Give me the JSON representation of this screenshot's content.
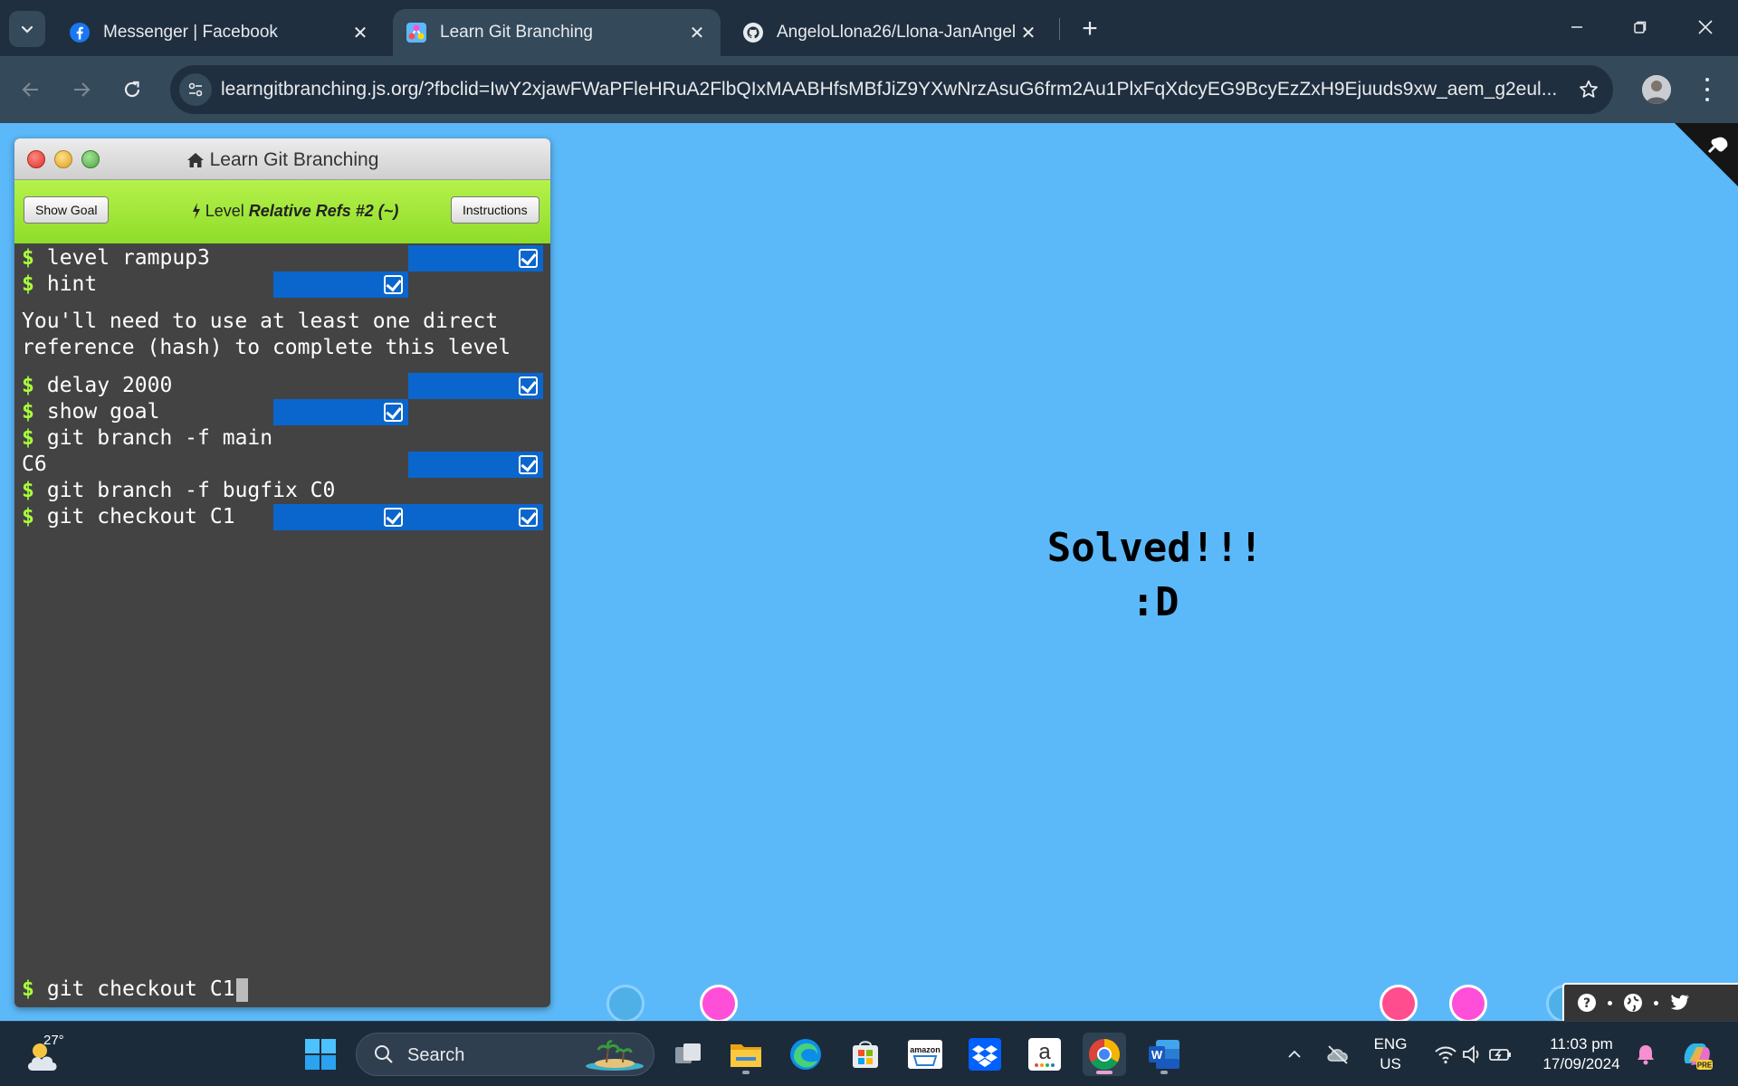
{
  "browser": {
    "tabs": [
      {
        "title": "Messenger | Facebook",
        "icon": "facebook-icon",
        "active": false
      },
      {
        "title": "Learn Git Branching",
        "icon": "git-branching-icon",
        "active": true
      },
      {
        "title": "AngeloLlona26/Llona-JanAngel",
        "icon": "github-icon",
        "active": false
      }
    ],
    "new_tab_label": "+",
    "url": "learngitbranching.js.org/?fbclid=IwY2xjawFWaPFleHRuA2FlbQIxMAABHfsMBfJiZ9YXwNrzAsuG6frm2Au1PlxFqXdcyEG9BcyEzZxH9Ejuuds9xw_aem_g2eul..."
  },
  "gitwindow": {
    "title": "Learn Git Branching",
    "show_goal_label": "Show Goal",
    "instructions_label": "Instructions",
    "level_prefix": "Level",
    "level_name": "Relative Refs #2 (~)",
    "prompt_symbol": "$",
    "history": [
      {
        "cmd": "level rampup3"
      },
      {
        "cmd": "hint"
      },
      {
        "output": "You'll need to use at least one direct reference (hash) to complete this level"
      },
      {
        "cmd": "delay 2000"
      },
      {
        "cmd": "show goal"
      },
      {
        "cmd": "git branch -f main"
      },
      {
        "output": "C6"
      },
      {
        "cmd": "git branch -f bugfix C0"
      },
      {
        "cmd": "git checkout C1"
      }
    ],
    "current_input": "git checkout C1"
  },
  "canvas": {
    "solved_line1": "Solved!!!",
    "solved_line2": ":D"
  },
  "taskbar": {
    "weather_temp": "27°",
    "search_placeholder": "Search",
    "language_line1": "ENG",
    "language_line2": "US",
    "time": "11:03 pm",
    "date": "17/09/2024"
  },
  "colors": {
    "page_background": "#5cb9f9",
    "level_bar": "#9be53a",
    "prompt": "#a9ff3b",
    "success_bar": "#0a66cc",
    "terminal": "#434343"
  }
}
